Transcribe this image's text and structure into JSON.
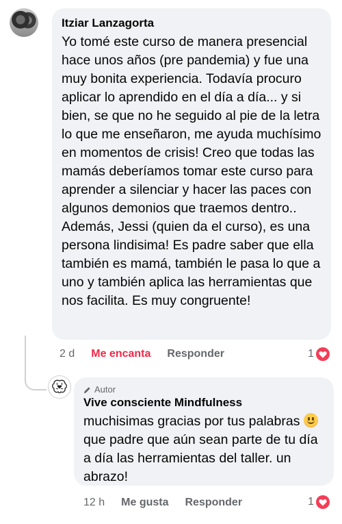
{
  "comment": {
    "author": "Itziar Lanzagorta",
    "text": "Yo tomé este curso de manera presencial hace unos años (pre pandemia) y fue una muy bonita experiencia. Todavía procuro aplicar lo aprendido en el día a día... y si bien, se que no he seguido al pie de la letra lo que me enseñaron, me ayuda muchísimo en momentos de crisis! Creo que todas las mamás deberíamos tomar este curso para aprender a silenciar y hacer las paces con algunos demonios que traemos dentro.. Además, Jessi (quien da el curso), es una persona lindisima! Es padre saber que ella también es mamá, también le pasa lo que a uno y también aplica las herramientas que nos facilita. Es muy congruente!",
    "time": "2 d",
    "reaction_label": "Me encanta",
    "reply_label": "Responder",
    "reaction_count": "1",
    "reaction_icon": "heart-icon",
    "reaction_color": "#f02849"
  },
  "reply": {
    "badge": "Autor",
    "badge_icon": "pencil-icon",
    "author": "Vive consciente Mindfulness",
    "text_before_emoji": "muchisimas gracias por tus palabras",
    "emoji": "slightly-smiling-face",
    "text_after_emoji": "que padre que aún sean parte de tu día a día las herramientas del taller. un abrazo!",
    "time": "12 h",
    "like_label": "Me gusta",
    "reply_label": "Responder",
    "reaction_count": "1",
    "reaction_icon": "heart-icon"
  },
  "colors": {
    "bubble": "#f0f2f5",
    "meta_text": "#65676b",
    "heart_badge": "#f33e58"
  }
}
